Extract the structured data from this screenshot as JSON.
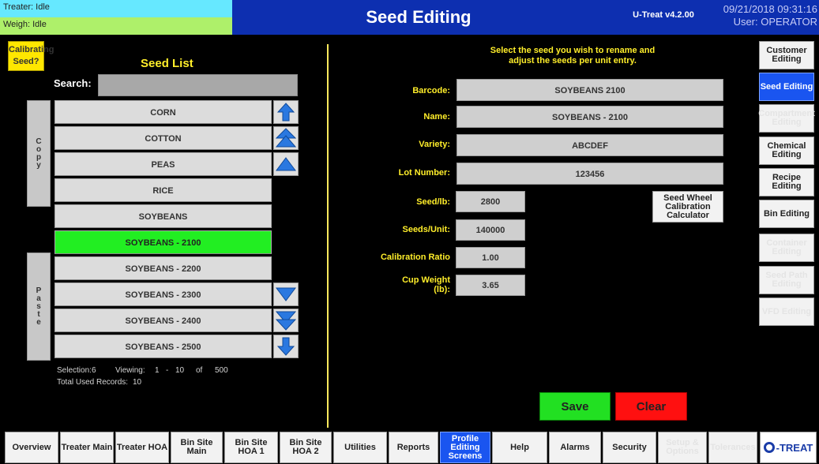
{
  "header": {
    "treater_status": "Treater: Idle",
    "weigh_status": "Weigh: Idle",
    "title": "Seed Editing",
    "version": "U-Treat v4.2.00",
    "datetime": "09/21/2018 09:31:16",
    "user": "User: OPERATOR"
  },
  "left": {
    "calibrating_label": "Calibrating Seed?",
    "seed_list_title": "Seed List",
    "search_label": "Search:",
    "search_value": "",
    "copy_label": "C o p y",
    "paste_label": "P a s t e",
    "seeds": [
      {
        "name": "CORN",
        "selected": false
      },
      {
        "name": "COTTON",
        "selected": false
      },
      {
        "name": "PEAS",
        "selected": false
      },
      {
        "name": "RICE",
        "selected": false
      },
      {
        "name": "SOYBEANS",
        "selected": false
      },
      {
        "name": "SOYBEANS - 2100",
        "selected": true
      },
      {
        "name": "SOYBEANS - 2200",
        "selected": false
      },
      {
        "name": "SOYBEANS - 2300",
        "selected": false
      },
      {
        "name": "SOYBEANS - 2400",
        "selected": false
      },
      {
        "name": "SOYBEANS - 2500",
        "selected": false
      }
    ],
    "selection_label": "Selection:",
    "selection_value": "6",
    "viewing_label": "Viewing:",
    "viewing_from": "1",
    "viewing_dash": "-",
    "viewing_to": "10",
    "of_label": "of",
    "total": "500",
    "total_used_label": "Total Used Records:",
    "total_used_value": "10"
  },
  "form": {
    "instructions_line1": "Select the seed you wish to rename and",
    "instructions_line2": "adjust the seeds per unit entry.",
    "barcode_label": "Barcode:",
    "barcode_value": "SOYBEANS 2100",
    "name_label": "Name:",
    "name_value": "SOYBEANS - 2100",
    "variety_label": "Variety:",
    "variety_value": "ABCDEF",
    "lot_label": "Lot Number:",
    "lot_value": "123456",
    "seedlb_label": "Seed/lb:",
    "seedlb_value": "2800",
    "seedsunit_label": "Seeds/Unit:",
    "seedsunit_value": "140000",
    "calratio_label": "Calibration Ratio",
    "calratio_value": "1.00",
    "cupweight_label_1": "Cup Weight",
    "cupweight_label_2": "(lb):",
    "cupweight_value": "3.65",
    "calc_line1": "Seed Wheel",
    "calc_line2": "Calibration",
    "calc_line3": "Calculator",
    "save_label": "Save",
    "clear_label": "Clear"
  },
  "right_nav": [
    {
      "label": "Customer Editing",
      "state": "normal"
    },
    {
      "label": "Seed Editing",
      "state": "active"
    },
    {
      "label": "Compartment Editing",
      "state": "disabled"
    },
    {
      "label": "Chemical Editing",
      "state": "normal"
    },
    {
      "label": "Recipe Editing",
      "state": "normal"
    },
    {
      "label": "Bin Editing",
      "state": "normal"
    },
    {
      "label": "Container Editing",
      "state": "disabled"
    },
    {
      "label": "Seed Path Editing",
      "state": "disabled"
    },
    {
      "label": "VFD Editing",
      "state": "disabled"
    }
  ],
  "bottom_nav": [
    {
      "label": "Overview",
      "state": "normal"
    },
    {
      "label": "Treater Main",
      "state": "normal"
    },
    {
      "label": "Treater HOA",
      "state": "normal"
    },
    {
      "label": "Bin Site Main",
      "state": "normal"
    },
    {
      "label": "Bin Site HOA 1",
      "state": "normal"
    },
    {
      "label": "Bin Site HOA 2",
      "state": "normal"
    },
    {
      "label": "Utilities",
      "state": "normal"
    },
    {
      "label": "Reports",
      "state": "normal"
    },
    {
      "label": "Profile Editing Screens",
      "state": "active"
    },
    {
      "label": "Help",
      "state": "normal"
    },
    {
      "label": "Alarms",
      "state": "normal"
    },
    {
      "label": "Security",
      "state": "normal"
    },
    {
      "label": "Setup & Options",
      "state": "disabled"
    },
    {
      "label": "Tolerances",
      "state": "disabled"
    }
  ],
  "logo_text": "-TREAT",
  "colors": {
    "header_blue": "#0d2fb0",
    "selected_row": "#22ee22",
    "active_nav": "#1a55f0",
    "label_yellow": "#ffee2a",
    "save_green": "#22e022",
    "clear_red": "#ff1010"
  }
}
